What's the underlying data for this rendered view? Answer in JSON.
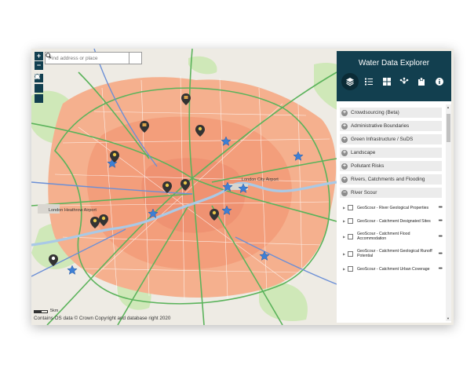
{
  "search": {
    "placeholder": "Find address or place"
  },
  "zoom": {
    "in_label": "+",
    "out_label": "−"
  },
  "attribution": "Contains OS data © Crown Copyright and database right 2020",
  "scale": {
    "label": "5km"
  },
  "map_labels": [
    "London City Airport",
    "London Heathrow Airport"
  ],
  "panel": {
    "title": "Water Data Explorer",
    "tabs": [
      "layers-icon",
      "list-icon",
      "grid-icon",
      "share-icon",
      "bookmark-icon",
      "info-icon"
    ],
    "categories": [
      {
        "label": "Crowdsourcing (Beta)",
        "state": "+"
      },
      {
        "label": "Administrative Boundaries",
        "state": "+"
      },
      {
        "label": "Green Infrastructure / SuDS",
        "state": "+"
      },
      {
        "label": "Landscape",
        "state": "+"
      },
      {
        "label": "Pollutant Risks",
        "state": "+"
      },
      {
        "label": "Rivers, Catchments and Flooding",
        "state": "+"
      },
      {
        "label": "River Scour",
        "state": "−"
      }
    ],
    "layers": [
      {
        "label": "GeoScour - River Geological Properties",
        "more": "•••"
      },
      {
        "label": "GeoScour - Catchment Designated Sites",
        "more": "•••"
      },
      {
        "label": "GeoScour - Catchment Flood Accommodation",
        "more": "•••"
      },
      {
        "label": "GeoScour - Catchment Geological Runoff Potential",
        "more": "•••"
      },
      {
        "label": "GeoScour - Catchment Urban Coverage",
        "more": "•••"
      }
    ]
  },
  "colors": {
    "panel_header": "#123f4f",
    "urban": "#f3a07d",
    "roads_major": "#5bb35b",
    "river": "#a9c9e6",
    "star_marker": "#3d7fd4",
    "pin_marker": "#333333"
  }
}
